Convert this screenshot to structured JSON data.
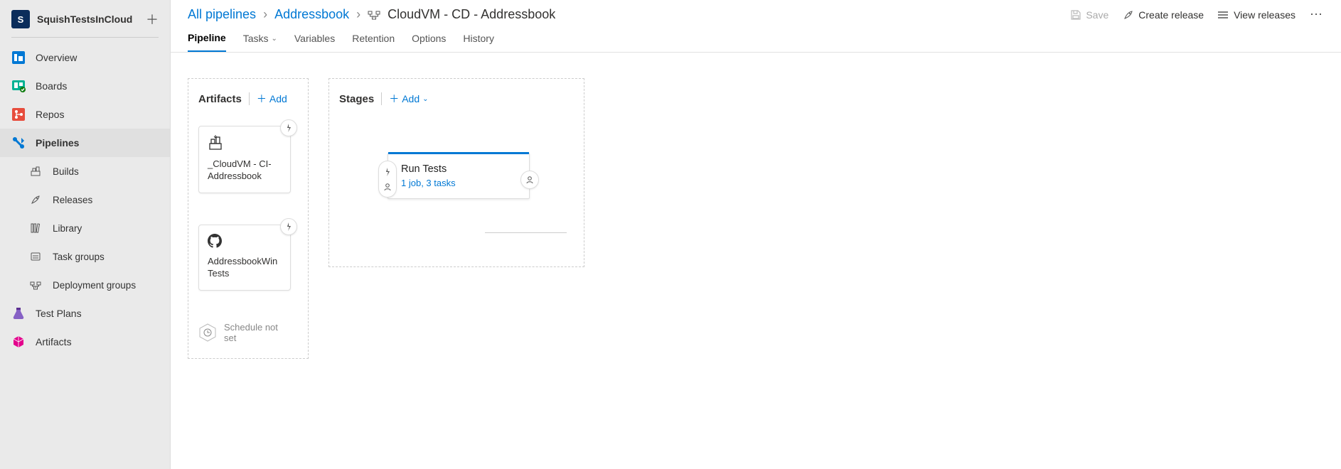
{
  "project": {
    "badge": "S",
    "name": "SquishTestsInCloud"
  },
  "nav": {
    "overview": "Overview",
    "boards": "Boards",
    "repos": "Repos",
    "pipelines": "Pipelines",
    "builds": "Builds",
    "releases": "Releases",
    "library": "Library",
    "task_groups": "Task groups",
    "deployment_groups": "Deployment groups",
    "test_plans": "Test Plans",
    "artifacts": "Artifacts"
  },
  "breadcrumb": {
    "root": "All pipelines",
    "folder": "Addressbook",
    "name": "CloudVM - CD - Addressbook"
  },
  "actions": {
    "save": "Save",
    "create_release": "Create release",
    "view_releases": "View releases"
  },
  "tabs": {
    "pipeline": "Pipeline",
    "tasks": "Tasks",
    "variables": "Variables",
    "retention": "Retention",
    "options": "Options",
    "history": "History"
  },
  "panels": {
    "artifacts_title": "Artifacts",
    "stages_title": "Stages",
    "add": "Add"
  },
  "artifacts": [
    {
      "name": "_CloudVM - CI-Addressbook",
      "source": "build"
    },
    {
      "name": "AddressbookWinTests",
      "source": "github"
    }
  ],
  "schedule": {
    "label": "Schedule not set"
  },
  "stage": {
    "name": "Run Tests",
    "subtitle": "1 job, 3 tasks"
  }
}
